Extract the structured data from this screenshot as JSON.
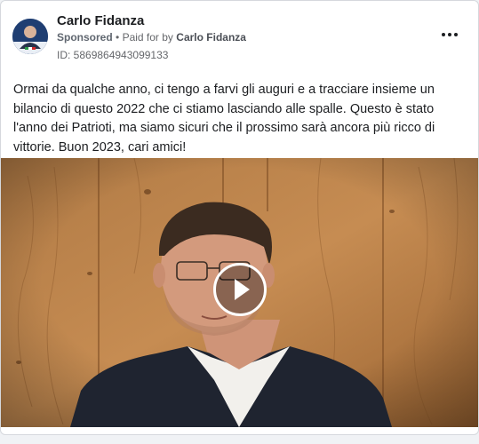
{
  "post": {
    "advertiser_name": "Carlo Fidanza",
    "sponsored_label": "Sponsored",
    "separator": "•",
    "paid_for_label": "Paid for by",
    "paid_for_name": "Carlo Fidanza",
    "library_id": "ID: 5869864943099133",
    "body": "Ormai da qualche anno, ci tengo a farvi gli auguri e a tracciare insieme un bilancio di questo 2022 che ci stiamo lasciando alle spalle. Questo è stato l'anno dei Patrioti, ma siamo sicuri che il prossimo sarà ancora più ricco di vittorie. Buon 2023, cari amici!"
  },
  "icons": {
    "more": "more-options-icon",
    "play": "play-icon"
  },
  "colors": {
    "text_primary": "#1c1e21",
    "text_secondary": "#65676b",
    "card_border": "#d5d8dd",
    "page_background": "#f0f2f5"
  }
}
